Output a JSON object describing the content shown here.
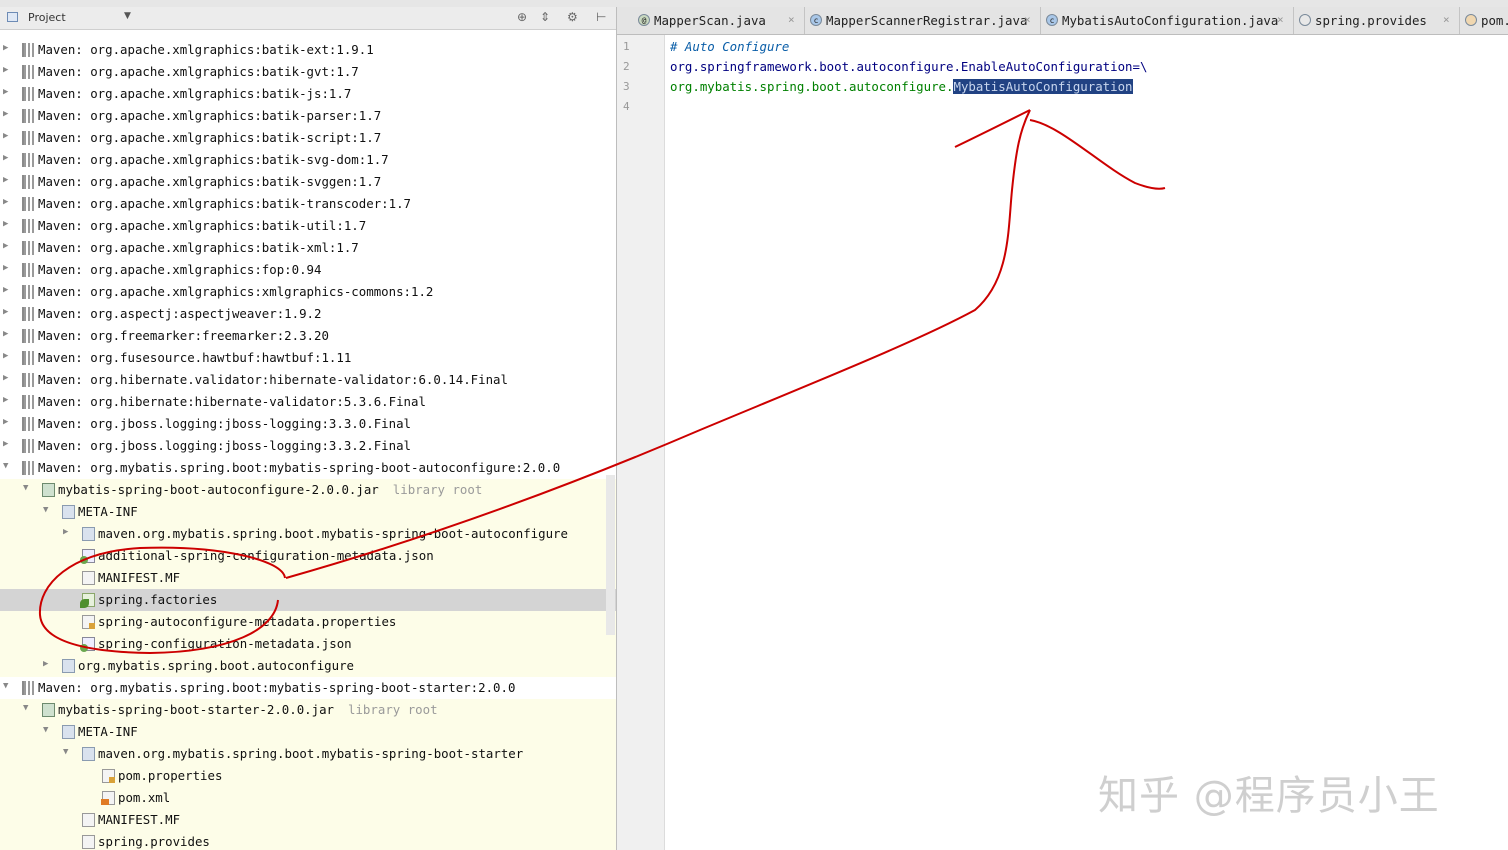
{
  "panel": {
    "title": "Project",
    "dropdown_icon": "chevron-down-icon",
    "tools": [
      "sync-icon",
      "collapse-icon",
      "gear-icon",
      "hide-icon"
    ]
  },
  "tree": [
    {
      "text": "Maven: org.apache.xmlgraphics:batik-ext:1.9.1",
      "icon": "library-icon",
      "arrow": "▶"
    },
    {
      "text": "Maven: org.apache.xmlgraphics:batik-gvt:1.7",
      "icon": "library-icon",
      "arrow": "▶"
    },
    {
      "text": "Maven: org.apache.xmlgraphics:batik-js:1.7",
      "icon": "library-icon",
      "arrow": "▶"
    },
    {
      "text": "Maven: org.apache.xmlgraphics:batik-parser:1.7",
      "icon": "library-icon",
      "arrow": "▶"
    },
    {
      "text": "Maven: org.apache.xmlgraphics:batik-script:1.7",
      "icon": "library-icon",
      "arrow": "▶"
    },
    {
      "text": "Maven: org.apache.xmlgraphics:batik-svg-dom:1.7",
      "icon": "library-icon",
      "arrow": "▶"
    },
    {
      "text": "Maven: org.apache.xmlgraphics:batik-svggen:1.7",
      "icon": "library-icon",
      "arrow": "▶"
    },
    {
      "text": "Maven: org.apache.xmlgraphics:batik-transcoder:1.7",
      "icon": "library-icon",
      "arrow": "▶"
    },
    {
      "text": "Maven: org.apache.xmlgraphics:batik-util:1.7",
      "icon": "library-icon",
      "arrow": "▶"
    },
    {
      "text": "Maven: org.apache.xmlgraphics:batik-xml:1.7",
      "icon": "library-icon",
      "arrow": "▶"
    },
    {
      "text": "Maven: org.apache.xmlgraphics:fop:0.94",
      "icon": "library-icon",
      "arrow": "▶"
    },
    {
      "text": "Maven: org.apache.xmlgraphics:xmlgraphics-commons:1.2",
      "icon": "library-icon",
      "arrow": "▶"
    },
    {
      "text": "Maven: org.aspectj:aspectjweaver:1.9.2",
      "icon": "library-icon",
      "arrow": "▶"
    },
    {
      "text": "Maven: org.freemarker:freemarker:2.3.20",
      "icon": "library-icon",
      "arrow": "▶"
    },
    {
      "text": "Maven: org.fusesource.hawtbuf:hawtbuf:1.11",
      "icon": "library-icon",
      "arrow": "▶"
    },
    {
      "text": "Maven: org.hibernate.validator:hibernate-validator:6.0.14.Final",
      "icon": "library-icon",
      "arrow": "▶"
    },
    {
      "text": "Maven: org.hibernate:hibernate-validator:5.3.6.Final",
      "icon": "library-icon",
      "arrow": "▶"
    },
    {
      "text": "Maven: org.jboss.logging:jboss-logging:3.3.0.Final",
      "icon": "library-icon",
      "arrow": "▶"
    },
    {
      "text": "Maven: org.jboss.logging:jboss-logging:3.3.2.Final",
      "icon": "library-icon",
      "arrow": "▶"
    },
    {
      "text": "Maven: org.mybatis.spring.boot:mybatis-spring-boot-autoconfigure:2.0.0",
      "icon": "library-icon",
      "arrow": "▼"
    },
    {
      "text": "mybatis-spring-boot-autoconfigure-2.0.0.jar",
      "suffix": "library root",
      "icon": "jar-icon",
      "arrow": "▼",
      "level": 1
    },
    {
      "text": "META-INF",
      "icon": "folder-icon",
      "arrow": "▼",
      "level": 2
    },
    {
      "text": "maven.org.mybatis.spring.boot.mybatis-spring-boot-autoconfigure",
      "icon": "folder-icon",
      "arrow": "▶",
      "level": 3
    },
    {
      "text": "additional-spring-configuration-metadata.json",
      "icon": "json-icon",
      "arrow": "",
      "level": 3
    },
    {
      "text": "MANIFEST.MF",
      "icon": "manifest-icon",
      "arrow": "",
      "level": 3
    },
    {
      "text": "spring.factories",
      "icon": "spring-leaf-icon",
      "arrow": "",
      "level": 3,
      "selected": true
    },
    {
      "text": "spring-autoconfigure-metadata.properties",
      "icon": "properties-icon",
      "arrow": "",
      "level": 3
    },
    {
      "text": "spring-configuration-metadata.json",
      "icon": "json-icon",
      "arrow": "",
      "level": 3
    },
    {
      "text": "org.mybatis.spring.boot.autoconfigure",
      "icon": "package-icon",
      "arrow": "▶",
      "level": 2
    },
    {
      "text": "Maven: org.mybatis.spring.boot:mybatis-spring-boot-starter:2.0.0",
      "icon": "library-icon",
      "arrow": "▼"
    },
    {
      "text": "mybatis-spring-boot-starter-2.0.0.jar",
      "suffix": "library root",
      "icon": "jar-icon",
      "arrow": "▼",
      "level": 1
    },
    {
      "text": "META-INF",
      "icon": "folder-icon",
      "arrow": "▼",
      "level": 2
    },
    {
      "text": "maven.org.mybatis.spring.boot.mybatis-spring-boot-starter",
      "icon": "folder-icon",
      "arrow": "▼",
      "level": 3
    },
    {
      "text": "pom.properties",
      "icon": "properties-icon",
      "arrow": "",
      "level": 4
    },
    {
      "text": "pom.xml",
      "icon": "xml-icon",
      "arrow": "",
      "level": 4
    },
    {
      "text": "MANIFEST.MF",
      "icon": "manifest-icon",
      "arrow": "",
      "level": 3
    },
    {
      "text": "spring.provides",
      "icon": "file-icon",
      "arrow": "",
      "level": 3
    }
  ],
  "tabs": [
    {
      "label": "MapperScan.java",
      "icon": "annotation-icon",
      "glyph": "@",
      "color": "#c9d9c0"
    },
    {
      "label": "MapperScannerRegistrar.java",
      "icon": "class-icon",
      "glyph": "c",
      "color": "#a9c7e8"
    },
    {
      "label": "MybatisAutoConfiguration.java",
      "icon": "class-icon",
      "glyph": "c",
      "color": "#a9c7e8"
    },
    {
      "label": "spring.provides",
      "icon": "file-icon",
      "glyph": "",
      "color": "#e8e8e8"
    },
    {
      "label": "pom.xml",
      "icon": "xml-icon",
      "glyph": "",
      "color": "#f0d7b0"
    }
  ],
  "close_glyph": "×",
  "editor": {
    "line_numbers": [
      "1",
      "2",
      "3",
      "4"
    ],
    "lines": [
      {
        "comment": "# Auto Configure"
      },
      {
        "key": "org.springframework.boot.autoconfigure.EnableAutoConfiguration=\\"
      },
      {
        "value": "org.mybatis.spring.boot.autoconfigure.",
        "selected": "MybatisAutoConfiguration"
      },
      {}
    ]
  },
  "colors": {
    "annotation": "#cc0000",
    "selection": "#214283",
    "library_bg": "#fdfde8"
  },
  "watermark": "知乎 @程序员小王"
}
